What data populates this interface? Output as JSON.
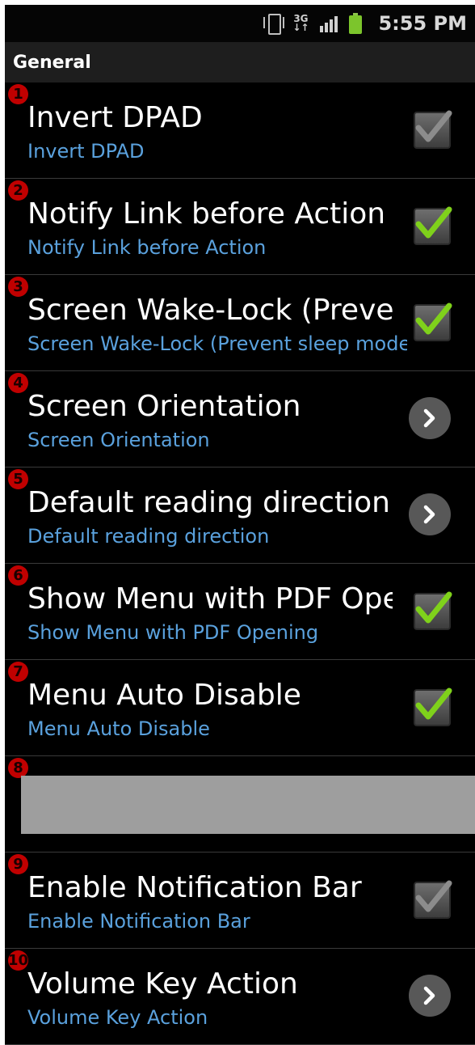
{
  "status_bar": {
    "time": "5:55 PM",
    "network": "3G",
    "icons": [
      "vibrate-icon",
      "network-3g-icon",
      "signal-bars-icon",
      "battery-icon"
    ]
  },
  "section": {
    "title": "General"
  },
  "colors": {
    "accent_summary": "#5aa1dd",
    "check_green": "#7fd11b",
    "badge_red": "#c00000"
  },
  "items": [
    {
      "badge": "1",
      "title": "Invert DPAD",
      "summary": "Invert DPAD",
      "control": "checkbox",
      "checked": false
    },
    {
      "badge": "2",
      "title": "Notify Link before Action",
      "summary": "Notify Link before Action",
      "control": "checkbox",
      "checked": true
    },
    {
      "badge": "3",
      "title": "Screen Wake-Lock (Preve",
      "summary": "Screen Wake-Lock (Prevent sleep mode)",
      "control": "checkbox",
      "checked": true
    },
    {
      "badge": "4",
      "title": "Screen Orientation",
      "summary": "Screen Orientation",
      "control": "arrow"
    },
    {
      "badge": "5",
      "title": "Default reading direction",
      "summary": "Default reading direction",
      "control": "arrow"
    },
    {
      "badge": "6",
      "title": "Show Menu with PDF Ope",
      "summary": "Show Menu with PDF Opening",
      "control": "checkbox",
      "checked": true
    },
    {
      "badge": "7",
      "title": "Menu Auto Disable",
      "summary": "Menu Auto Disable",
      "control": "checkbox",
      "checked": true
    },
    {
      "badge": "8",
      "title": "",
      "summary": "",
      "control": "masked"
    },
    {
      "badge": "9",
      "title": "Enable Notification Bar",
      "summary": "Enable Notification Bar",
      "control": "checkbox",
      "checked": false
    },
    {
      "badge": "10",
      "title": "Volume Key Action",
      "summary": "Volume Key Action",
      "control": "arrow"
    }
  ]
}
